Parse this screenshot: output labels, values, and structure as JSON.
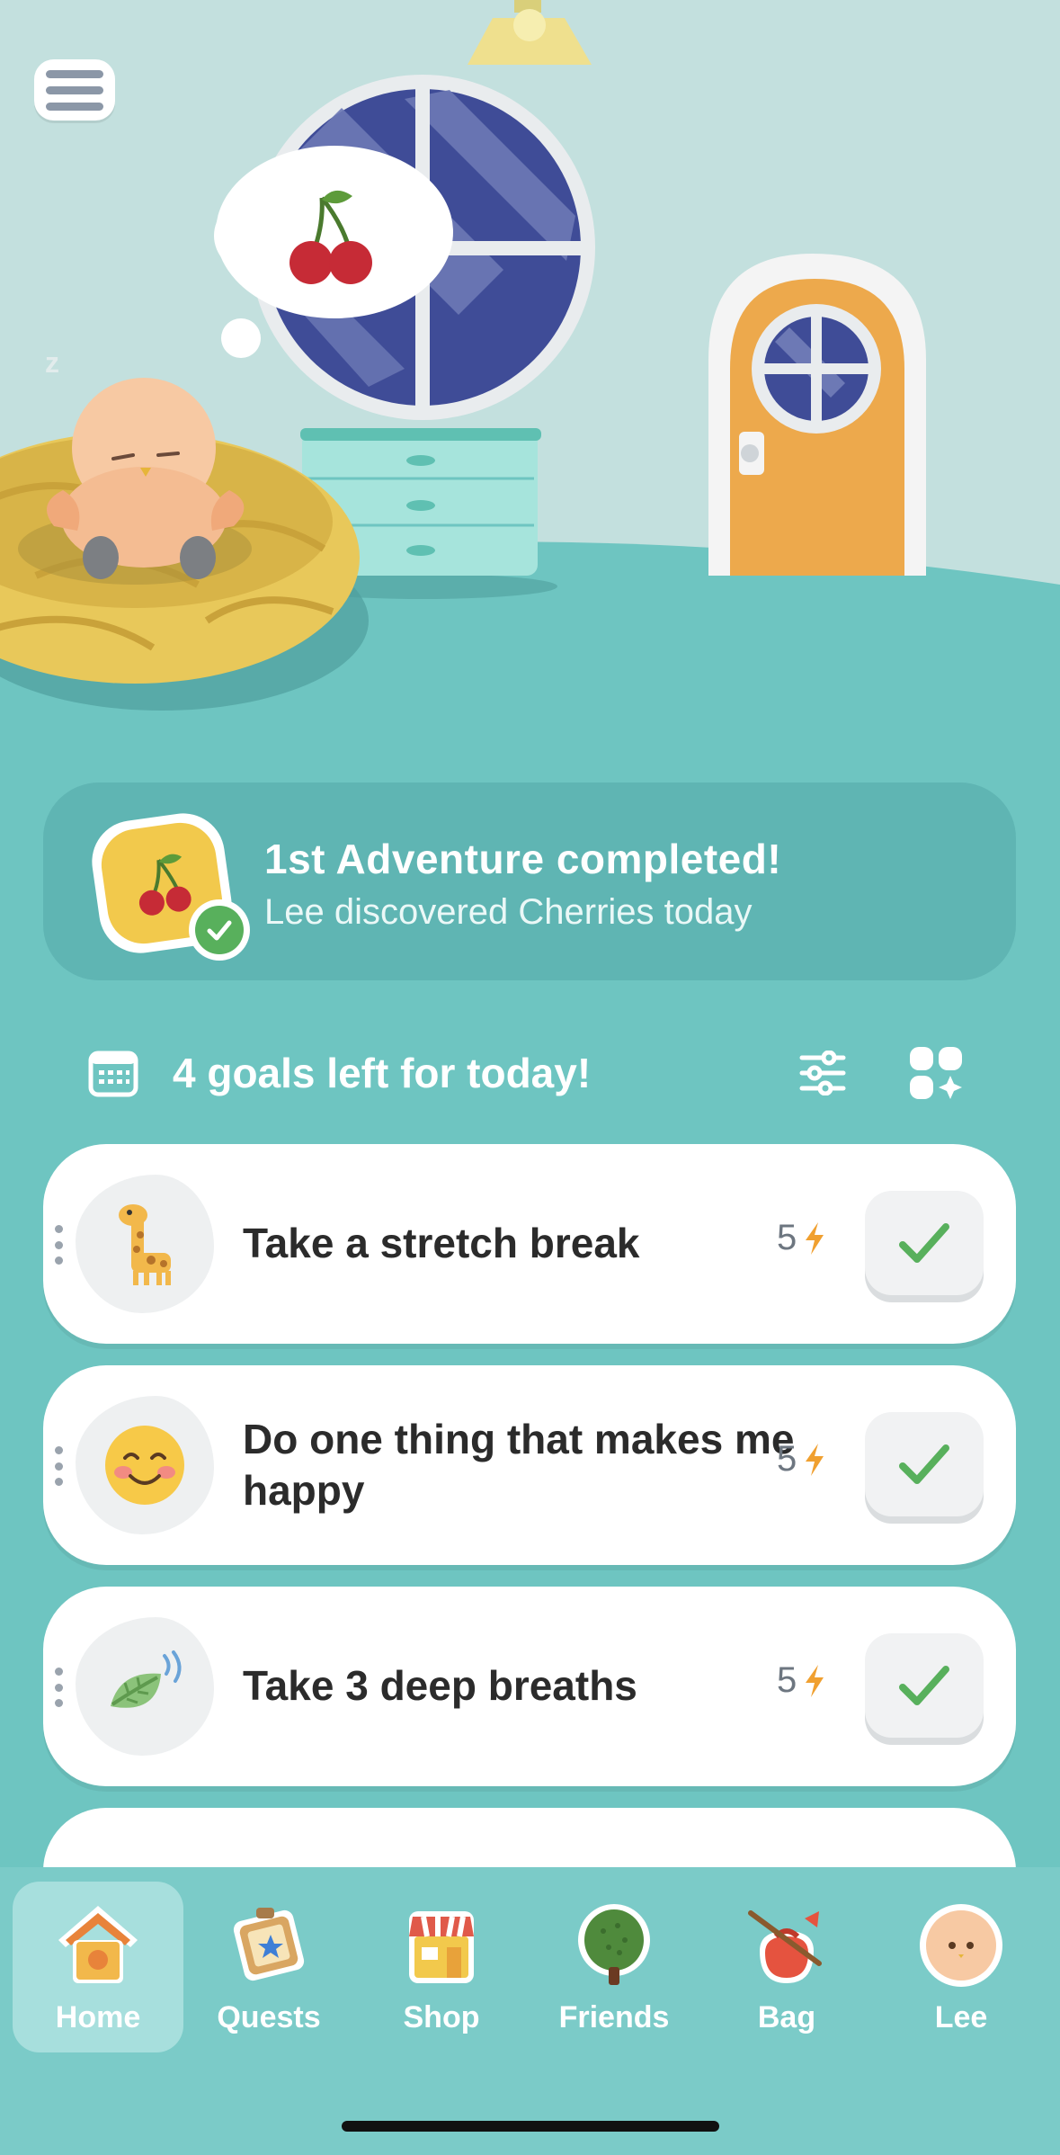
{
  "header": {
    "menu_icon": "hamburger-menu-icon"
  },
  "scene": {
    "thought_item": "cherries",
    "sleeping_text": "z"
  },
  "adventure": {
    "title": "1st Adventure completed!",
    "subtitle": "Lee discovered Cherries today",
    "badge_icon": "cherries-icon",
    "status_icon": "check-icon"
  },
  "goals": {
    "header_text": "4 goals left for today!",
    "calendar_icon": "calendar-icon",
    "filter_icon": "sliders-icon",
    "add_icon": "add-goal-icon",
    "items": [
      {
        "label": "Take a stretch break",
        "points": "5",
        "icon": "giraffe-icon"
      },
      {
        "label": "Do one thing that makes me happy",
        "points": "5",
        "icon": "smiling-face-icon"
      },
      {
        "label": "Take 3 deep breaths",
        "points": "5",
        "icon": "leaf-wind-icon"
      }
    ]
  },
  "tabs": [
    {
      "label": "Home",
      "icon": "birdhouse-icon",
      "active": true
    },
    {
      "label": "Quests",
      "icon": "map-icon",
      "active": false
    },
    {
      "label": "Shop",
      "icon": "shop-icon",
      "active": false
    },
    {
      "label": "Friends",
      "icon": "tree-icon",
      "active": false
    },
    {
      "label": "Bag",
      "icon": "bag-icon",
      "active": false
    },
    {
      "label": "Lee",
      "icon": "avatar-icon",
      "active": false
    }
  ],
  "colors": {
    "background": "#6ec5c1",
    "wall": "#c3e0de",
    "card": "#5fb5b3",
    "tabbar": "#7bcbc8",
    "check_green": "#58b05c",
    "bolt_orange": "#f0a030"
  }
}
